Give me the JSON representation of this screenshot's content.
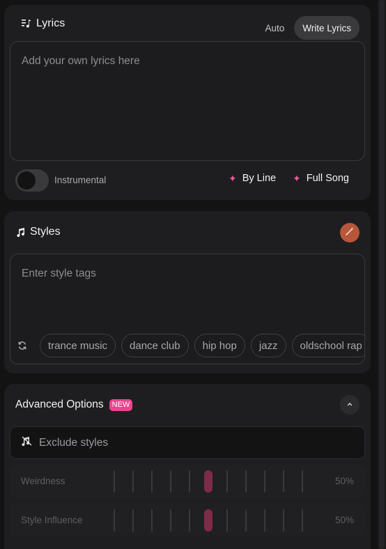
{
  "lyrics": {
    "title": "Lyrics",
    "mode_auto": "Auto",
    "mode_write": "Write Lyrics",
    "placeholder": "Add your own lyrics here",
    "instrumental_label": "Instrumental",
    "instrumental_on": false,
    "by_line": "By Line",
    "full_song": "Full Song"
  },
  "styles": {
    "title": "Styles",
    "placeholder": "Enter style tags",
    "tags": [
      "trance music",
      "dance club",
      "hip hop",
      "jazz",
      "oldschool rap"
    ]
  },
  "advanced": {
    "title": "Advanced Options",
    "badge": "NEW",
    "exclude_placeholder": "Exclude styles",
    "sliders": [
      {
        "label": "Weirdness",
        "value": "50%",
        "fraction": 0.5
      },
      {
        "label": "Style Influence",
        "value": "50%",
        "fraction": 0.5
      }
    ]
  },
  "colors": {
    "accent_pink": "#e85a9a",
    "badge_pink": "#e8458f",
    "slider_thumb": "#7f2a46",
    "magic_orange": "#b7563a"
  }
}
